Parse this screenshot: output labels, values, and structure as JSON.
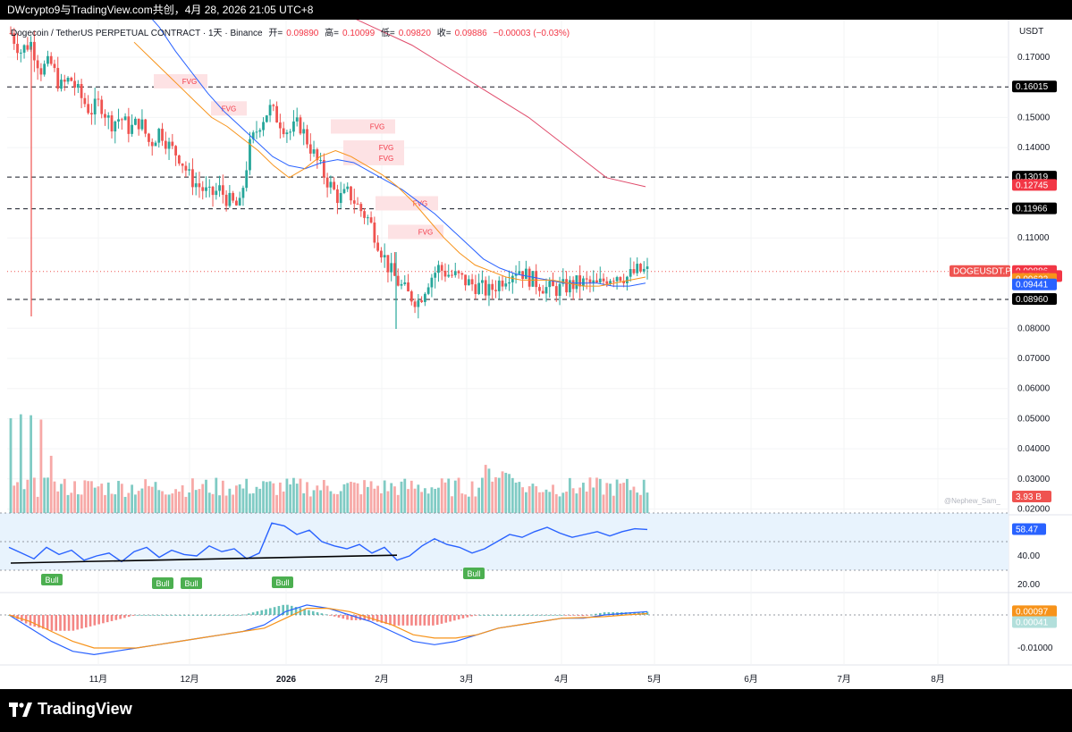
{
  "header": {
    "title": "DWcrypto9与TradingView.com共创，4月 28, 2026 21:05 UTC+8"
  },
  "legend": {
    "symbol": "Dogecoin / TetherUS PERPETUAL CONTRACT · 1天 · Binance",
    "open_label": "开=",
    "open": "0.09890",
    "high_label": "高=",
    "high": "0.10099",
    "low_label": "低=",
    "low": "0.09820",
    "close_label": "收=",
    "close": "0.09886",
    "change": "−0.00003 (−0.03%)"
  },
  "currency_label": "USDT",
  "watermark": "@Nephew_Sam_",
  "footer": {
    "brand": "TradingView"
  },
  "colors": {
    "up": "#26a69a",
    "down": "#ef5350",
    "ema_fast": "#f7931a",
    "ema_slow": "#2962ff",
    "ma_long": "#e04b6b",
    "rsi": "#2962ff",
    "macd_line": "#2962ff",
    "signal_line": "#f7931a",
    "bull_label": "#4caf50",
    "fvg_fill": "#fde2e4",
    "fvg_text": "#f23645"
  },
  "chart_data": [
    {
      "type": "candlestick",
      "title": "Dogecoin / TetherUS PERPETUAL CONTRACT · 1天 · Binance",
      "x_labels": [
        "11月",
        "12月",
        "2026",
        "2月",
        "3月",
        "4月",
        "5月",
        "6月",
        "7月",
        "8月"
      ],
      "y_ticks": [
        "0.17000",
        "0.15000",
        "0.14000",
        "0.11000",
        "0.08000",
        "0.07000",
        "0.06000",
        "0.05000",
        "0.04000",
        "0.03000",
        "0.02000"
      ],
      "ylim": [
        0.02,
        0.18
      ],
      "close_path": [
        0.178,
        0.172,
        0.175,
        0.166,
        0.168,
        0.16,
        0.163,
        0.157,
        0.152,
        0.155,
        0.148,
        0.15,
        0.146,
        0.149,
        0.141,
        0.146,
        0.14,
        0.137,
        0.13,
        0.127,
        0.124,
        0.126,
        0.122,
        0.12,
        0.14,
        0.148,
        0.153,
        0.149,
        0.145,
        0.148,
        0.141,
        0.134,
        0.128,
        0.123,
        0.125,
        0.12,
        0.116,
        0.108,
        0.1,
        0.095,
        0.091,
        0.089,
        0.096,
        0.1,
        0.098,
        0.097,
        0.095,
        0.094,
        0.092,
        0.095,
        0.098,
        0.1,
        0.097,
        0.095,
        0.093,
        0.093,
        0.094,
        0.095,
        0.095,
        0.094,
        0.097,
        0.098,
        0.097,
        0.099,
        0.0988
      ],
      "ema_fast_path": [
        0.175,
        0.17,
        0.165,
        0.16,
        0.155,
        0.15,
        0.147,
        0.143,
        0.139,
        0.134,
        0.13,
        0.133,
        0.137,
        0.139,
        0.137,
        0.134,
        0.131,
        0.127,
        0.122,
        0.116,
        0.11,
        0.105,
        0.101,
        0.099,
        0.097,
        0.096,
        0.096,
        0.096,
        0.095,
        0.094,
        0.094,
        0.095,
        0.096,
        0.097
      ],
      "ema_slow_path": [
        0.186,
        0.18,
        0.172,
        0.165,
        0.158,
        0.152,
        0.147,
        0.142,
        0.137,
        0.134,
        0.133,
        0.135,
        0.136,
        0.135,
        0.132,
        0.129,
        0.126,
        0.122,
        0.118,
        0.113,
        0.108,
        0.103,
        0.1,
        0.098,
        0.097,
        0.096,
        0.095,
        0.095,
        0.095,
        0.094,
        0.094,
        0.095
      ],
      "ma_long_path": [
        0.192,
        0.186,
        0.18,
        0.174,
        0.166,
        0.158,
        0.15,
        0.14,
        0.13,
        0.127
      ],
      "horizontal_levels": [
        "0.16015",
        "0.13019",
        "0.11966",
        "0.08960"
      ],
      "price_tags": [
        {
          "label": "0.16015",
          "value": 0.16015,
          "color": "#000000"
        },
        {
          "label": "0.13019",
          "value": 0.13019,
          "color": "#000000"
        },
        {
          "label": "0.12745",
          "value": 0.12745,
          "color": "#f23645"
        },
        {
          "label": "0.11966",
          "value": 0.11966,
          "color": "#000000"
        },
        {
          "label": "0.09886",
          "value": 0.09886,
          "color": "#f23645"
        },
        {
          "label": "10:54:46",
          "value": 0.0972,
          "color": "#f23645"
        },
        {
          "label": "0.09622",
          "value": 0.09622,
          "color": "#f7931a"
        },
        {
          "label": "0.09441",
          "value": 0.09441,
          "color": "#2962ff"
        },
        {
          "label": "0.08960",
          "value": 0.0896,
          "color": "#000000"
        }
      ],
      "symbol_tag": "DOGEUSDT.P",
      "fvg_labels": [
        "FVG",
        "FVG",
        "FVG",
        "FVG",
        "FVG",
        "FVG",
        "FVG"
      ],
      "volume_tag": "3.93 B"
    },
    {
      "type": "line",
      "title": "",
      "y_ticks": [
        "60.00",
        "40.00",
        "20.00"
      ],
      "ylim": [
        20,
        70
      ],
      "value_tag": "58.47",
      "bull_labels": [
        "Bull",
        "Bull",
        "Bull",
        "Bull",
        "Bull"
      ],
      "rsi_path": [
        46,
        42,
        38,
        46,
        41,
        44,
        37,
        40,
        42,
        36,
        43,
        46,
        39,
        44,
        41,
        40,
        47,
        43,
        45,
        38,
        42,
        63,
        61,
        55,
        58,
        50,
        47,
        45,
        48,
        42,
        46,
        37,
        40,
        47,
        52,
        48,
        46,
        42,
        45,
        50,
        55,
        53,
        57,
        60,
        56,
        53,
        55,
        57,
        54,
        57,
        59,
        58.47
      ]
    },
    {
      "type": "line",
      "title": "",
      "y_ticks": [
        "-0.01000"
      ],
      "ylim": [
        -0.016,
        0.005
      ],
      "value_tags": [
        "0.00097",
        "0.00041"
      ],
      "macd_path": [
        0.0,
        -0.004,
        -0.008,
        -0.011,
        -0.012,
        -0.011,
        -0.01,
        -0.009,
        -0.008,
        -0.007,
        -0.006,
        -0.005,
        -0.003,
        0.001,
        0.003,
        0.002,
        0.0,
        -0.002,
        -0.005,
        -0.008,
        -0.009,
        -0.008,
        -0.006,
        -0.004,
        -0.003,
        -0.002,
        -0.001,
        -0.001,
        0.0,
        0.0005,
        0.001
      ],
      "signal_path": [
        0.0,
        -0.002,
        -0.005,
        -0.008,
        -0.01,
        -0.01,
        -0.01,
        -0.009,
        -0.008,
        -0.007,
        -0.006,
        -0.005,
        -0.004,
        -0.001,
        0.002,
        0.002,
        0.001,
        -0.001,
        -0.003,
        -0.006,
        -0.007,
        -0.007,
        -0.006,
        -0.004,
        -0.003,
        -0.002,
        -0.001,
        -0.0008,
        -0.0005,
        0.0,
        0.0004
      ]
    }
  ]
}
